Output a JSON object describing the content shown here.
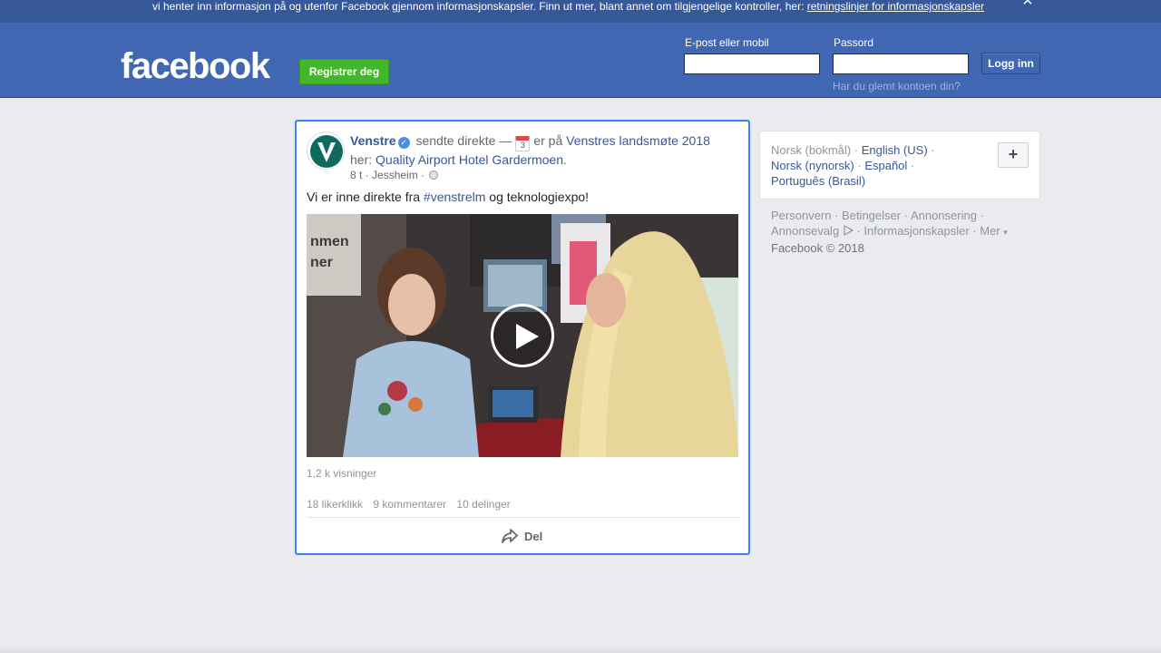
{
  "cookie_banner": {
    "text": "vi henter inn informasjon på og utenfor Facebook gjennom informasjonskapsler. Finn ut mer, blant annet om tilgjengelige kontroller, her: ",
    "link": "retningslinjer for informasjonskapsler",
    "close_glyph": "×"
  },
  "header": {
    "logo": "facebook",
    "register_label": "Registrer deg",
    "email_label": "E-post eller mobil",
    "email_value": "",
    "password_label": "Passord",
    "password_value": "",
    "login_label": "Logg inn",
    "forgot_label": "Har du glemt kontoen din?"
  },
  "post": {
    "page_name": "Venstre",
    "verified_glyph": "✓",
    "action_text": "sendte direkte —",
    "calendar_day": "3",
    "at_text": "er på",
    "event_name": "Venstres landsmøte 2018",
    "here_text": "her:",
    "place_name": "Quality Airport Hotel Gardermoen",
    "period": ".",
    "time": "8 t",
    "location": "Jessheim",
    "separator": "·",
    "text_before": "Vi er inne direkte fra ",
    "hashtag": "#venstrelm",
    "text_after": " og teknologiexpo!",
    "views": "1,2 k visninger",
    "likes": "18 likerklikk",
    "comments": "9 kommentarer",
    "shares": "10 delinger",
    "share_label": "Del",
    "video_sign_line1": "nmen",
    "video_sign_line2": "ner"
  },
  "sidebar": {
    "current_language": "Norsk (bokmål)",
    "dot": " · ",
    "languages": [
      "English (US)",
      "Norsk (nynorsk)",
      "Español",
      "Português (Brasil)"
    ],
    "add_glyph": "+",
    "footer": [
      "Personvern",
      "Betingelser",
      "Annonsering",
      "Annonsevalg",
      "Informasjonskapsler",
      "Mer"
    ],
    "more_glyph": "▾",
    "copyright": "Facebook © 2018"
  },
  "colors": {
    "header_blue": "#4267b2",
    "banner_blue": "#365899",
    "register_green": "#42b72a",
    "link_blue": "#365899",
    "focus_border": "#4080ff"
  }
}
